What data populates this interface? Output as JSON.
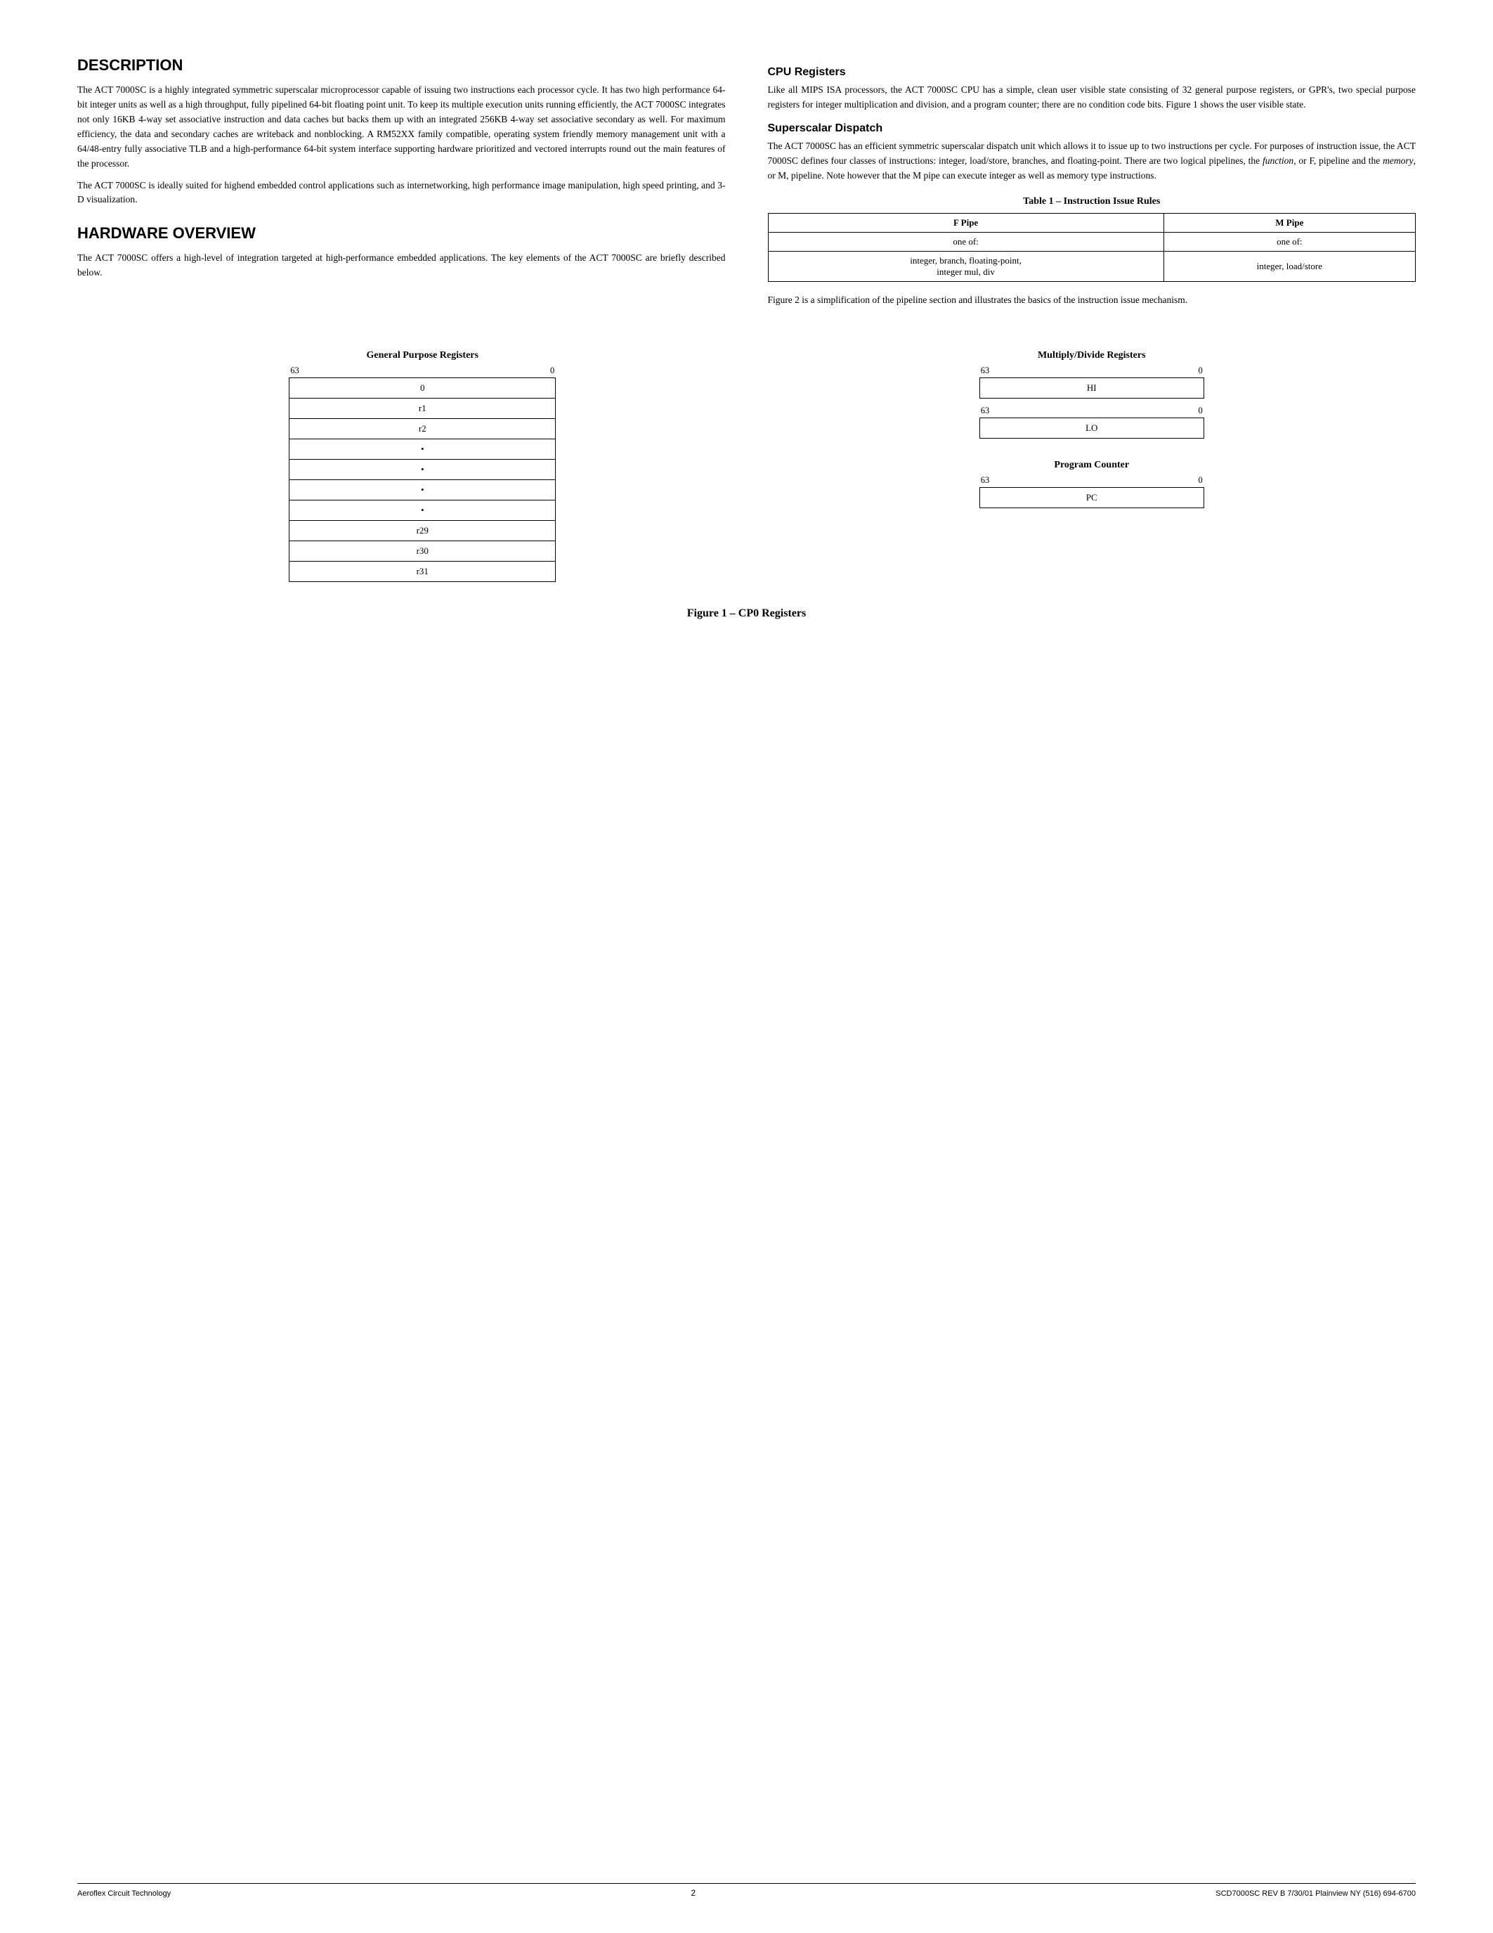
{
  "sections": {
    "description": {
      "title": "DESCRIPTION",
      "paragraphs": [
        "The ACT 7000SC is a highly integrated symmetric superscalar microprocessor capable of issuing two instructions each processor cycle. It has two high performance 64-bit integer units as well as a high throughput, fully pipelined 64-bit floating point unit. To keep its multiple execution units running efficiently, the ACT 7000SC integrates not only 16KB 4-way set associative instruction and data caches but backs them up with an integrated 256KB 4-way set associative secondary as well. For maximum efficiency, the data and secondary caches are writeback and nonblocking. A RM52XX family compatible, operating system friendly memory management unit with a 64/48-entry fully associative TLB and a high-performance 64-bit system interface supporting hardware prioritized and vectored interrupts round out the main features of the processor.",
        "The ACT 7000SC is ideally suited for highend embedded control applications such as internetworking, high performance image manipulation, high speed printing, and 3-D visualization."
      ]
    },
    "hardware_overview": {
      "title": "HARDWARE OVERVIEW",
      "paragraph": "The ACT 7000SC offers a high-level of integration targeted at high-performance embedded applications. The key elements of the ACT 7000SC are briefly described below."
    },
    "cpu_registers": {
      "title": "CPU Registers",
      "paragraph": "Like all MIPS ISA processors, the ACT 7000SC CPU has a simple, clean user visible state consisting of 32 general purpose registers, or GPR's, two special purpose registers for integer multiplication and division, and a program counter; there are no condition code bits. Figure 1 shows the user visible state."
    },
    "superscalar_dispatch": {
      "title": "Superscalar Dispatch",
      "paragraph": "The ACT 7000SC has an efficient symmetric superscalar dispatch unit which allows it to issue up to two instructions per cycle. For purposes of instruction issue, the ACT 7000SC defines four classes of instructions: integer, load/store, branches, and floating-point. There are two logical pipelines, the function, or F, pipeline and the memory, or M, pipeline. Note however that the M pipe can execute integer as well as memory type instructions."
    },
    "table1": {
      "title": "Table 1 – Instruction Issue Rules",
      "headers": [
        "F Pipe",
        "M Pipe"
      ],
      "row1": [
        "one of:",
        "one of:"
      ],
      "row2": [
        "integer, branch, floating-point,\ninteger mul, div",
        "integer, load/store"
      ]
    },
    "figure1_caption_text": "Figure 2 is a simplification of the pipeline section and illustrates the basics of the instruction issue mechanism.",
    "gpr": {
      "title": "General Purpose Registers",
      "bit_left": "63",
      "bit_right": "0",
      "rows": [
        "0",
        "r1",
        "r2",
        "•",
        "•",
        "•",
        "•",
        "r29",
        "r30",
        "r31"
      ]
    },
    "mdr": {
      "title": "Multiply/Divide Registers",
      "bit_left": "63",
      "bit_right": "0",
      "rows_hi": [
        "HI"
      ],
      "bit_left2": "63",
      "bit_right2": "0",
      "rows_lo": [
        "LO"
      ]
    },
    "pc": {
      "title": "Program Counter",
      "bit_left": "63",
      "bit_right": "0",
      "rows": [
        "PC"
      ]
    },
    "figure_caption": "Figure 1 – CP0 Registers",
    "footer": {
      "left": "Aeroflex Circuit Technology",
      "center": "2",
      "right": "SCD7000SC REV B  7/30/01  Plainview NY (516) 694-6700"
    }
  }
}
